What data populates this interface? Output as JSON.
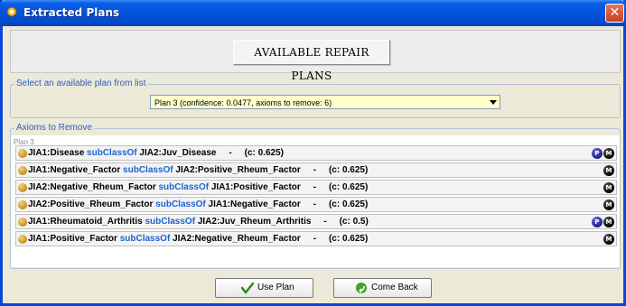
{
  "window": {
    "title": "Extracted Plans",
    "close_label": "✕"
  },
  "header": {
    "title": "AVAILABLE REPAIR PLANS"
  },
  "select_group": {
    "legend": "Select an available plan from list",
    "selected_value": "Plan 3 (confidence: 0.0477, axioms to remove: 6)"
  },
  "axioms_group": {
    "legend": "Axioms to Remove",
    "plan_label": "Plan 3",
    "rows": [
      {
        "subject": "JIA1:Disease ",
        "keyword": "subClassOf",
        "object": " JIA2:Juv_Disease",
        "sep": "-",
        "conf": "(c: 0.625)",
        "badges": [
          "P",
          "M"
        ]
      },
      {
        "subject": "JIA1:Negative_Factor ",
        "keyword": "subClassOf",
        "object": " JIA2:Positive_Rheum_Factor",
        "sep": "-",
        "conf": "(c: 0.625)",
        "badges": [
          "M"
        ]
      },
      {
        "subject": "JIA2:Negative_Rheum_Factor ",
        "keyword": "subClassOf",
        "object": " JIA1:Positive_Factor",
        "sep": "-",
        "conf": "(c: 0.625)",
        "badges": [
          "M"
        ]
      },
      {
        "subject": "JIA2:Positive_Rheum_Factor ",
        "keyword": "subClassOf",
        "object": " JIA1:Negative_Factor",
        "sep": "-",
        "conf": "(c: 0.625)",
        "badges": [
          "M"
        ]
      },
      {
        "subject": "JIA1:Rheumatoid_Arthritis ",
        "keyword": "subClassOf",
        "object": " JIA2:Juv_Rheum_Arthritis",
        "sep": "-",
        "conf": "(c: 0.5)",
        "badges": [
          "P",
          "M"
        ]
      },
      {
        "subject": "JIA1:Positive_Factor ",
        "keyword": "subClassOf",
        "object": " JIA2:Negative_Rheum_Factor",
        "sep": "-",
        "conf": "(c: 0.625)",
        "badges": [
          "M"
        ]
      }
    ]
  },
  "buttons": {
    "use_plan": "Use Plan",
    "come_back": "Come Back"
  },
  "icons": {
    "app": "gear-app-icon",
    "use_plan": "check-icon",
    "come_back": "back-arrow-icon",
    "bullet": "axiom-bullet-icon"
  },
  "colors": {
    "title_bar": "#0353d8",
    "keyword": "#1e64d2",
    "combo_bg": "#ffffcc",
    "legend": "#2f5bbd",
    "bullet": "#c69024"
  }
}
